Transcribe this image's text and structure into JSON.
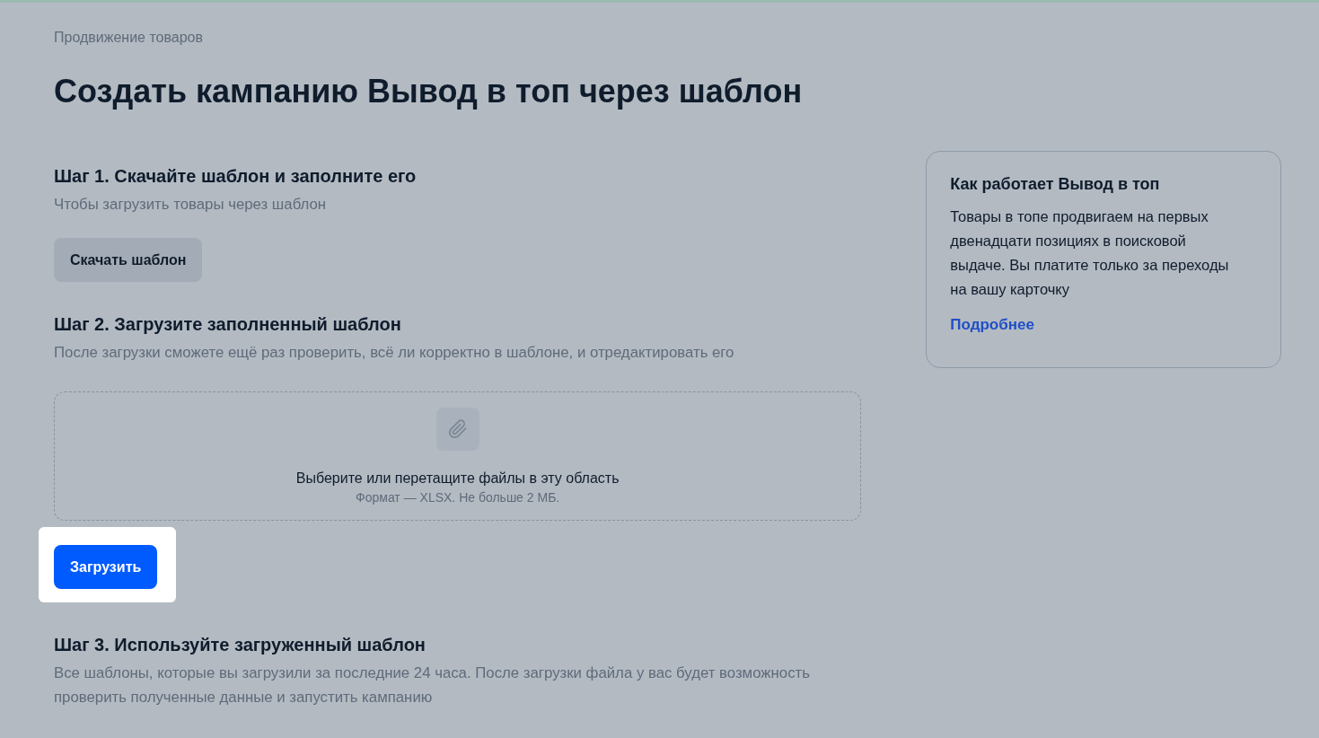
{
  "breadcrumb": "Продвижение товаров",
  "title": "Создать кампанию Вывод в топ через шаблон",
  "steps": [
    {
      "kind": "download",
      "title": "Шаг 1. Скачайте шаблон и заполните его",
      "description": "Чтобы загрузить товары через шаблон",
      "button": {
        "label": "Скачать шаблон",
        "highlighted": false
      }
    },
    {
      "kind": "upload",
      "title": "Шаг 2. Загрузите заполненный шаблон",
      "description": "После загрузки сможете ещё раз проверить, всё ли корректно в шаблоне, и отредактировать его",
      "dropzone": {
        "text": "Выберите или перетащите файлы в эту область",
        "hint": "Формат — XLSX. Не больше 2 МБ."
      },
      "button": {
        "label": "Загрузить",
        "highlighted": true
      }
    },
    {
      "kind": "list",
      "title": "Шаг 3. Используйте загруженный шаблон",
      "description": "Все шаблоны, которые вы загрузили за последние 24 часа. После загрузки файла у вас будет возможность проверить полученные данные и запустить кампанию"
    }
  ],
  "info_card": {
    "title": "Как работает Вывод в топ",
    "text": "Товары в топе продвигаем на первых двенадцати позициях в поисковой выдаче. Вы платите только за переходы на вашу карточку",
    "link": "Подробнее"
  }
}
